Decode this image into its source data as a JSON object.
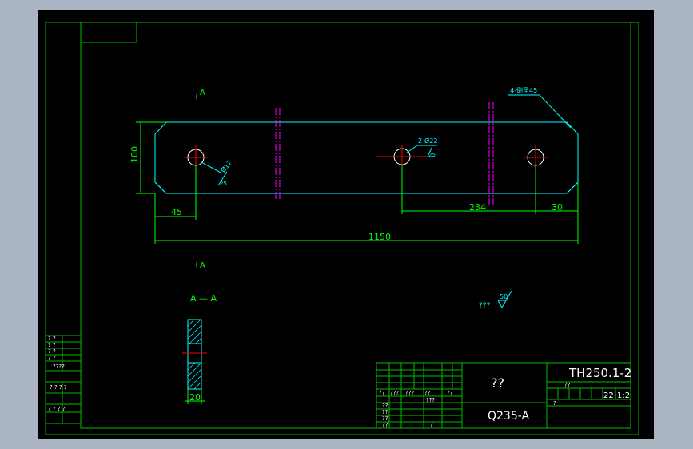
{
  "colors": {
    "background": "#aab4c2",
    "canvas": "#000000",
    "frame": "#00c000",
    "geometry": "#00ffff",
    "dimension": "#00ff00",
    "centerline": "#ff0000",
    "hidden_axis": "#ff00ff",
    "text": "#ffffff"
  },
  "drawing": {
    "section_marker_top": "A",
    "section_marker_bottom": "A",
    "section_title": "A — A",
    "dims": {
      "height": "100",
      "left_offset": "45",
      "hole_spacing": "234",
      "right_offset": "30",
      "overall_length": "1150",
      "section_thickness": "20"
    },
    "callouts": {
      "chamfer": "4-倒角45",
      "holes_label": "2-Ø22",
      "holes_roughness": "25",
      "left_hole_label": "Ø17",
      "left_hole_roughness": "25"
    },
    "roughness_note": {
      "text": "???",
      "value": "50"
    }
  },
  "title_block": {
    "part_name": "??",
    "drawing_number": "TH250.1-2",
    "material": "Q235-A",
    "quantity": "22",
    "scale": "1:2",
    "small_labels": [
      "??",
      "???",
      "???",
      "??",
      "??",
      "???",
      "??",
      "??",
      "??",
      "??",
      "?",
      "??",
      "?"
    ]
  },
  "left_strip": {
    "labels": [
      "? ?",
      "? ?",
      "? ?",
      "? ?",
      "????",
      "? ? ? ?",
      "? ? ?   ?"
    ]
  }
}
